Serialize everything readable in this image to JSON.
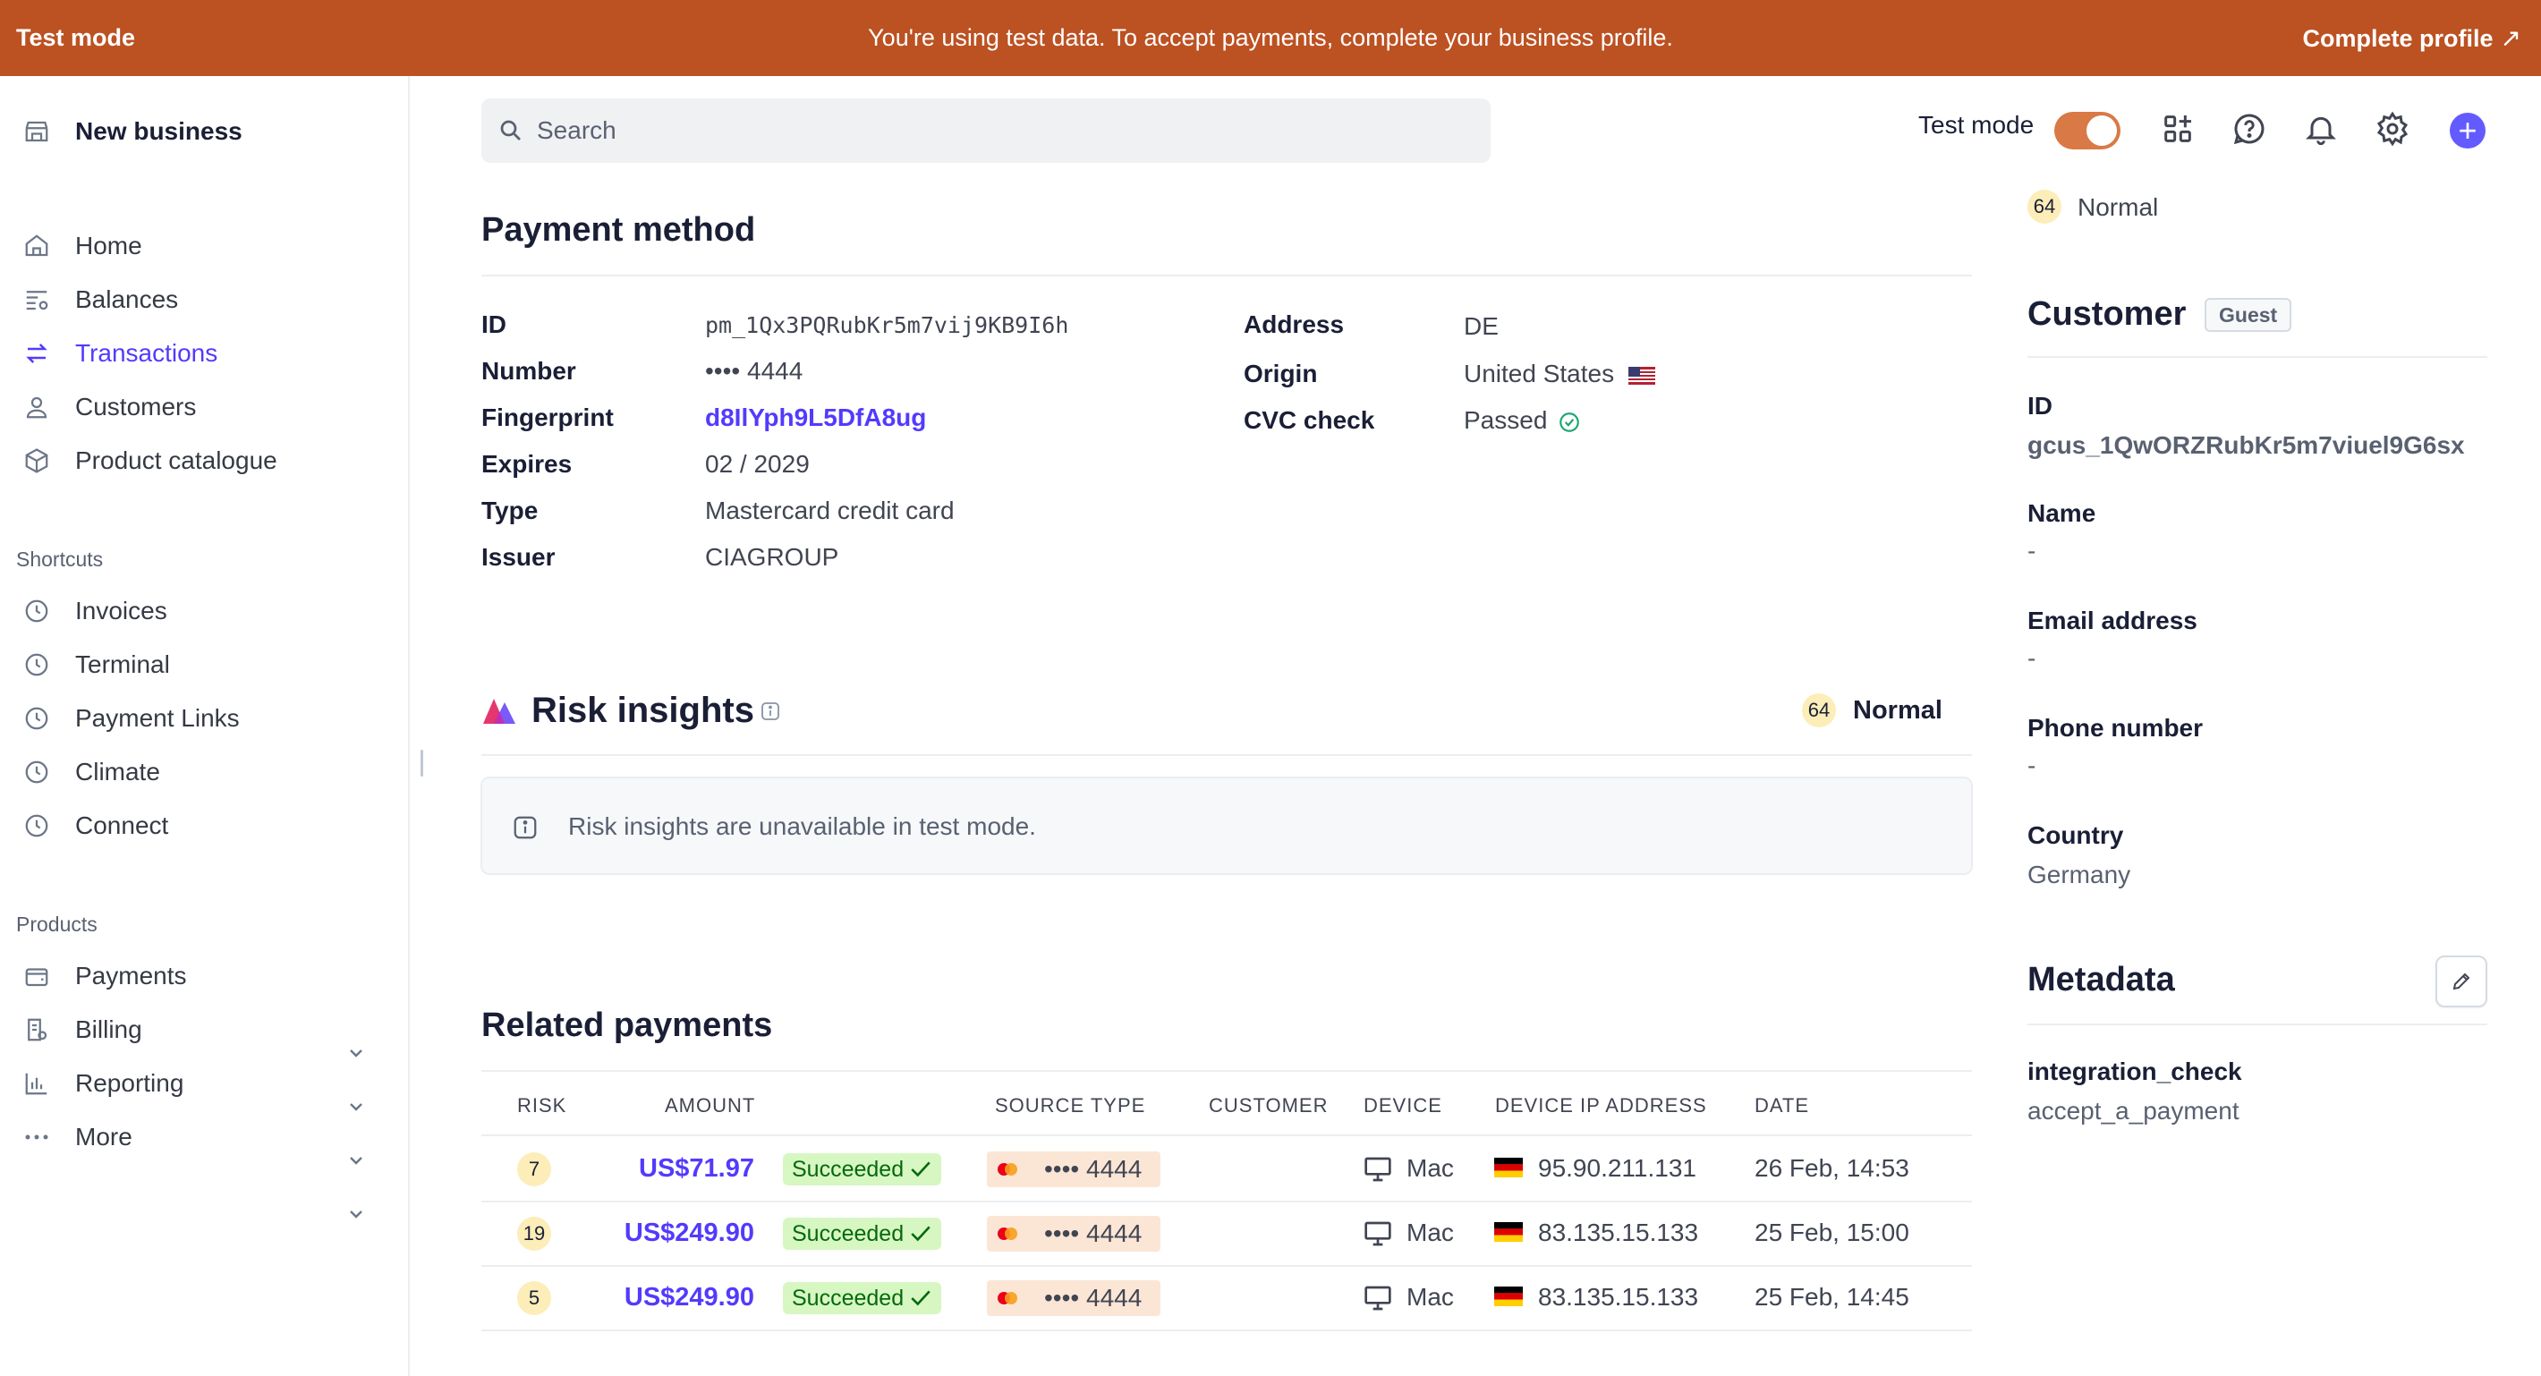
{
  "banner": {
    "mode_label": "Test mode",
    "message": "You're using test data. To accept payments, complete your business profile.",
    "cta": "Complete profile"
  },
  "sidebar": {
    "business_name": "New business",
    "nav": [
      {
        "label": "Home",
        "icon": "home-icon"
      },
      {
        "label": "Balances",
        "icon": "balances-icon"
      },
      {
        "label": "Transactions",
        "icon": "transactions-icon",
        "active": true
      },
      {
        "label": "Customers",
        "icon": "person-icon"
      },
      {
        "label": "Product catalogue",
        "icon": "box-icon"
      }
    ],
    "shortcuts_heading": "Shortcuts",
    "shortcuts": [
      {
        "label": "Invoices",
        "icon": "clock-icon"
      },
      {
        "label": "Terminal",
        "icon": "clock-icon"
      },
      {
        "label": "Payment Links",
        "icon": "clock-icon"
      },
      {
        "label": "Climate",
        "icon": "clock-icon"
      },
      {
        "label": "Connect",
        "icon": "clock-icon"
      }
    ],
    "products_heading": "Products",
    "products": [
      {
        "label": "Payments",
        "icon": "wallet-icon"
      },
      {
        "label": "Billing",
        "icon": "billing-icon"
      },
      {
        "label": "Reporting",
        "icon": "chart-icon"
      },
      {
        "label": "More",
        "icon": "dots-icon"
      }
    ]
  },
  "topbar": {
    "search_placeholder": "Search",
    "test_mode_label": "Test mode",
    "test_mode_on": true,
    "toggle_color": "#d97946",
    "accent": "#635bff"
  },
  "payment_method": {
    "title": "Payment method",
    "left": [
      {
        "label": "ID",
        "value": "pm_1Qx3PQRubKr5m7vij9KB9I6h"
      },
      {
        "label": "Number",
        "value": "•••• 4444"
      },
      {
        "label": "Fingerprint",
        "value": "d8IlYph9L5DfA8ug"
      },
      {
        "label": "Expires",
        "value": "02 / 2029"
      },
      {
        "label": "Type",
        "value": "Mastercard credit card"
      },
      {
        "label": "Issuer",
        "value": "CIAGROUP"
      }
    ],
    "right": [
      {
        "label": "Address",
        "value": "DE"
      },
      {
        "label": "Origin",
        "value": "United States"
      },
      {
        "label": "CVC check",
        "value": "Passed"
      }
    ]
  },
  "risk_insights": {
    "title": "Risk insights",
    "score": "64",
    "level": "Normal",
    "notice": "Risk insights are unavailable in test mode."
  },
  "related_payments": {
    "title": "Related payments",
    "columns": [
      "RISK",
      "AMOUNT",
      "SOURCE TYPE",
      "CUSTOMER",
      "DEVICE",
      "DEVICE IP ADDRESS",
      "DATE"
    ],
    "rows": [
      {
        "risk": "7",
        "amount": "US$71.97",
        "status": "Succeeded",
        "card": "•••• 4444",
        "customer": "",
        "device": "Mac",
        "ip": "95.90.211.131",
        "date": "26 Feb, 14:53"
      },
      {
        "risk": "19",
        "amount": "US$249.90",
        "status": "Succeeded",
        "card": "•••• 4444",
        "customer": "",
        "device": "Mac",
        "ip": "83.135.15.133",
        "date": "25 Feb, 15:00"
      },
      {
        "risk": "5",
        "amount": "US$249.90",
        "status": "Succeeded",
        "card": "•••• 4444",
        "customer": "",
        "device": "Mac",
        "ip": "83.135.15.133",
        "date": "25 Feb, 14:45"
      }
    ]
  },
  "right_panel": {
    "risk_score": "64",
    "risk_level": "Normal",
    "customer_title": "Customer",
    "customer_badge": "Guest",
    "fields": [
      {
        "label": "ID",
        "value": "gcus_1QwORZRubKr5m7viuel9G6sx"
      },
      {
        "label": "Name",
        "value": "-"
      },
      {
        "label": "Email address",
        "value": "-"
      },
      {
        "label": "Phone number",
        "value": "-"
      },
      {
        "label": "Country",
        "value": "Germany"
      }
    ],
    "metadata_title": "Metadata",
    "metadata": [
      {
        "key": "integration_check",
        "value": "accept_a_payment"
      }
    ]
  }
}
